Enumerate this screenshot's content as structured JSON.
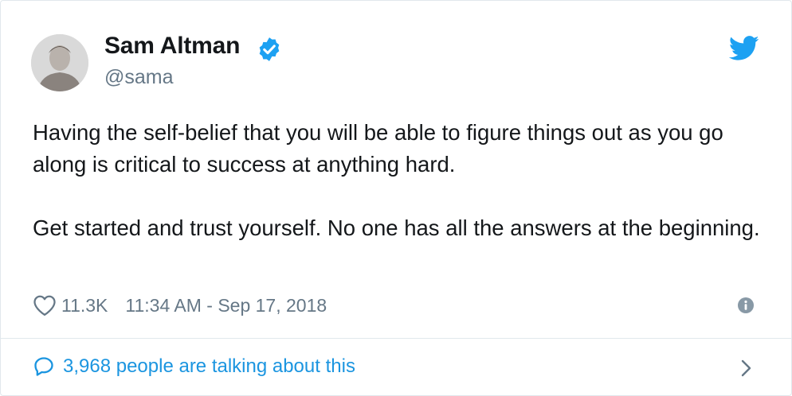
{
  "author": {
    "name": "Sam Altman",
    "handle": "@sama",
    "verified": true
  },
  "tweet": {
    "paragraphs": [
      "Having the self-belief that you will be able to figure things out as you go along is critical to success at anything hard.",
      "Get started and trust yourself. No one has all the answers at the beginning."
    ],
    "likes": "11.3K",
    "timestamp": "11:34 AM - Sep 17, 2018"
  },
  "conversation": {
    "label": "3,968 people are talking about this"
  },
  "icons": {
    "brand": "twitter-bird-icon",
    "verified": "verified-badge-icon",
    "like": "heart-icon",
    "info": "info-icon",
    "reply": "speech-bubble-icon",
    "more": "chevron-right-icon"
  },
  "colors": {
    "accent": "#1da1f2",
    "link": "#1b95e0",
    "text": "#14171a",
    "secondary": "#657786",
    "border": "#e1e8ed"
  }
}
